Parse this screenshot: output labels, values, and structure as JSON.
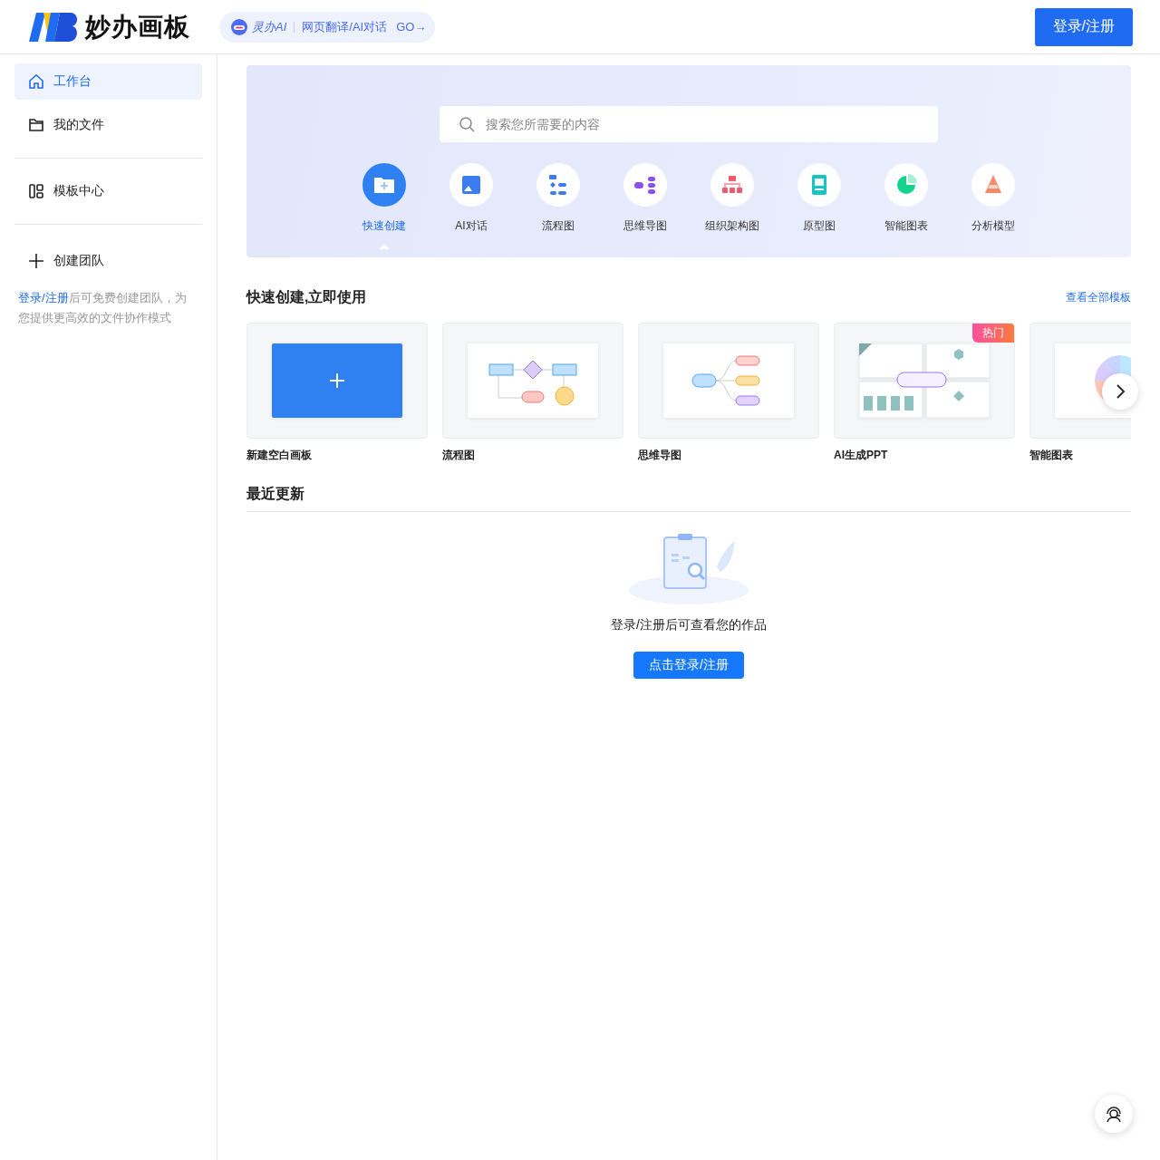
{
  "header": {
    "logo": "妙办画板",
    "promo": {
      "brand": "灵办AI",
      "text": "网页翻译/AI对话",
      "go": "GO→"
    },
    "login_button": "登录/注册"
  },
  "sidebar": {
    "items": [
      {
        "label": "工作台",
        "kind": "home",
        "selected": true
      },
      {
        "label": "我的文件",
        "kind": "folder",
        "selected": false
      },
      {
        "label": "模板中心",
        "kind": "template",
        "selected": false
      }
    ],
    "create_team": "创建团队",
    "hint": {
      "link": "登录/注册",
      "text": "后可免费创建团队，为您提供更高效的文件协作模式"
    }
  },
  "hero": {
    "search": {
      "placeholder": "搜索您所需要的内容"
    },
    "tools": [
      {
        "label": "快速创建",
        "kind": "quick",
        "selected": true
      },
      {
        "label": "AI对话",
        "kind": "ai",
        "selected": false
      },
      {
        "label": "流程图",
        "kind": "flow",
        "selected": false
      },
      {
        "label": "思维导图",
        "kind": "mind",
        "selected": false
      },
      {
        "label": "组织架构图",
        "kind": "org",
        "selected": false
      },
      {
        "label": "原型图",
        "kind": "proto",
        "selected": false
      },
      {
        "label": "智能图表",
        "kind": "chart",
        "selected": false
      },
      {
        "label": "分析模型",
        "kind": "model",
        "selected": false
      }
    ]
  },
  "quick_create": {
    "title": "快速创建,立即使用",
    "view_all": "查看全部模板",
    "templates": [
      {
        "label": "新建空白画板",
        "kind": "blank"
      },
      {
        "label": "流程图",
        "kind": "flow"
      },
      {
        "label": "思维导图",
        "kind": "mind"
      },
      {
        "label": "AI生成PPT",
        "kind": "slides",
        "badge": "热门"
      },
      {
        "label": "智能图表",
        "kind": "chart"
      }
    ]
  },
  "recent": {
    "title": "最近更新",
    "message": "登录/注册后可查看您的作品",
    "button": "点击登录/注册"
  }
}
